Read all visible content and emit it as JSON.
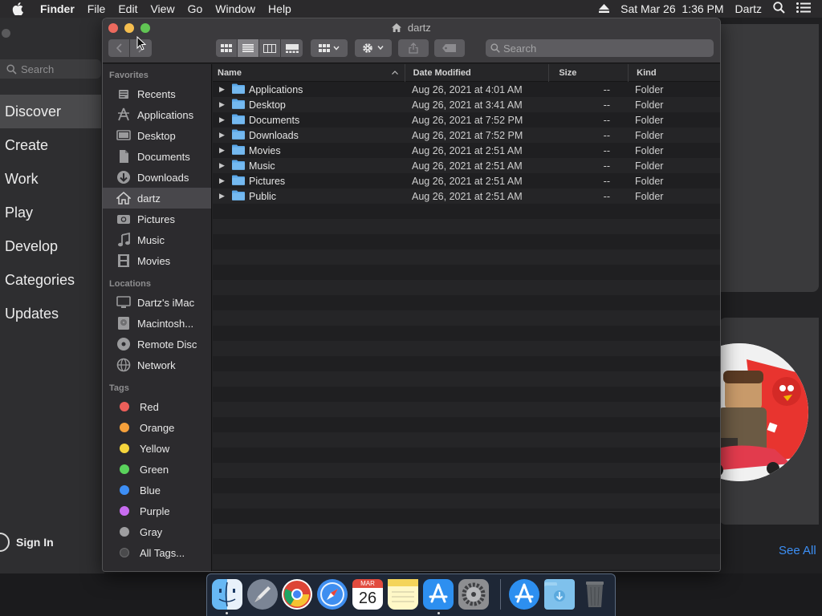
{
  "menubar": {
    "app_name": "Finder",
    "menus": [
      "File",
      "Edit",
      "View",
      "Go",
      "Window",
      "Help"
    ],
    "datetime": "Sat Mar 26  1:36 PM",
    "user": "Dartz"
  },
  "appstore": {
    "search_placeholder": "Search",
    "nav": [
      "Discover",
      "Create",
      "Work",
      "Play",
      "Develop",
      "Categories",
      "Updates"
    ],
    "active_nav": "Discover",
    "sign_in": "Sign In",
    "see_all": "See All"
  },
  "finder": {
    "title": "dartz",
    "search_placeholder": "Search",
    "sidebar": {
      "favorites_header": "Favorites",
      "favorites": [
        "Recents",
        "Applications",
        "Desktop",
        "Documents",
        "Downloads",
        "dartz",
        "Pictures",
        "Music",
        "Movies"
      ],
      "locations_header": "Locations",
      "locations": [
        "Dartz's iMac",
        "Macintosh...",
        "Remote Disc",
        "Network"
      ],
      "tags_header": "Tags",
      "tags": [
        {
          "label": "Red",
          "color": "#ed5f5a"
        },
        {
          "label": "Orange",
          "color": "#f5a03b"
        },
        {
          "label": "Yellow",
          "color": "#f5d53c"
        },
        {
          "label": "Green",
          "color": "#5ad35c"
        },
        {
          "label": "Blue",
          "color": "#3d8ef5"
        },
        {
          "label": "Purple",
          "color": "#c86cf0"
        },
        {
          "label": "Gray",
          "color": "#9e9ea0"
        },
        {
          "label": "All Tags...",
          "color": "#4a4a4c"
        }
      ]
    },
    "columns": {
      "name": "Name",
      "date": "Date Modified",
      "size": "Size",
      "kind": "Kind"
    },
    "files": [
      {
        "name": "Applications",
        "date": "Aug 26, 2021 at 4:01 AM",
        "size": "--",
        "kind": "Folder"
      },
      {
        "name": "Desktop",
        "date": "Aug 26, 2021 at 3:41 AM",
        "size": "--",
        "kind": "Folder"
      },
      {
        "name": "Documents",
        "date": "Aug 26, 2021 at 7:52 PM",
        "size": "--",
        "kind": "Folder"
      },
      {
        "name": "Downloads",
        "date": "Aug 26, 2021 at 7:52 PM",
        "size": "--",
        "kind": "Folder"
      },
      {
        "name": "Movies",
        "date": "Aug 26, 2021 at 2:51 AM",
        "size": "--",
        "kind": "Folder"
      },
      {
        "name": "Music",
        "date": "Aug 26, 2021 at 2:51 AM",
        "size": "--",
        "kind": "Folder"
      },
      {
        "name": "Pictures",
        "date": "Aug 26, 2021 at 2:51 AM",
        "size": "--",
        "kind": "Folder"
      },
      {
        "name": "Public",
        "date": "Aug 26, 2021 at 2:51 AM",
        "size": "--",
        "kind": "Folder"
      }
    ]
  },
  "dock": {
    "calendar_month": "MAR",
    "calendar_day": "26",
    "apps": [
      "finder",
      "launchpad",
      "chrome",
      "safari",
      "calendar",
      "notes",
      "app-store",
      "system-preferences",
      "app-store-download",
      "downloads-folder",
      "trash"
    ]
  }
}
